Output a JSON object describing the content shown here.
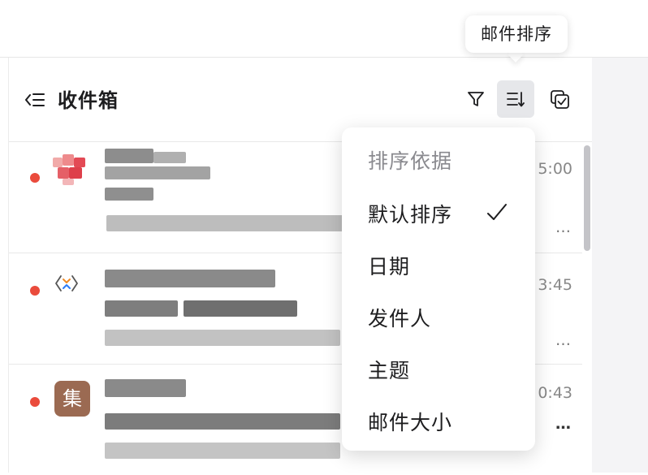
{
  "tooltip": {
    "text": "邮件排序"
  },
  "header": {
    "title": "收件箱",
    "icons": [
      "back-list-icon",
      "filter-icon",
      "sort-icon",
      "multi-select-icon"
    ]
  },
  "mail_list": {
    "rows": [
      {
        "time_fragment": "5:00",
        "unread": true,
        "avatar": "pixelated-avatar"
      },
      {
        "time_fragment": "3:45",
        "unread": true,
        "avatar": "code-brackets-icon"
      },
      {
        "time_fragment": "0:43",
        "unread": true,
        "avatar_text": "集",
        "avatar_color": "#9b6a52"
      }
    ]
  },
  "sort_menu": {
    "header": "排序依据",
    "items": [
      {
        "label": "默认排序",
        "selected": true
      },
      {
        "label": "日期",
        "selected": false
      },
      {
        "label": "发件人",
        "selected": false
      },
      {
        "label": "主题",
        "selected": false
      },
      {
        "label": "邮件大小",
        "selected": false
      }
    ]
  },
  "colors": {
    "unread_dot": "#ea4b3c",
    "active_button_bg": "#e6e7ea",
    "menu_header_text": "#8a8a8f"
  }
}
